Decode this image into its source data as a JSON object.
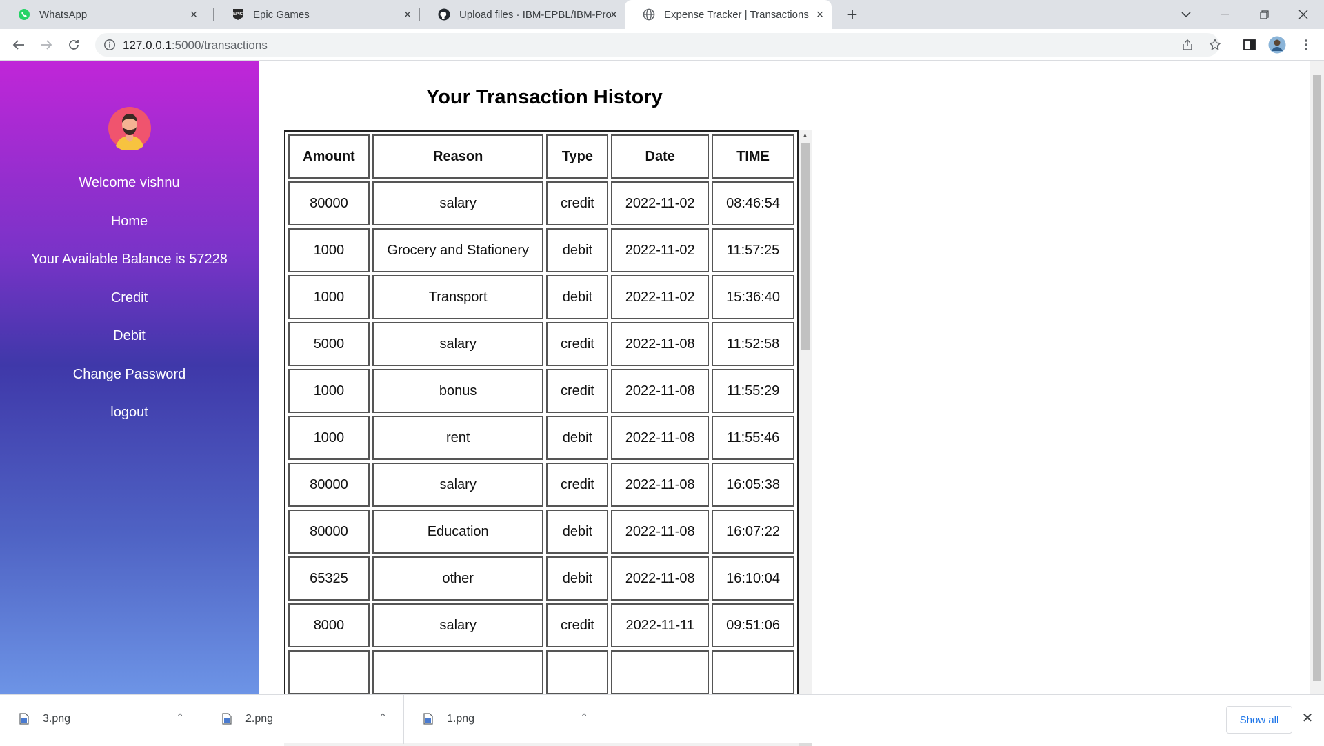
{
  "browser": {
    "tabs": [
      {
        "title": "WhatsApp",
        "icon": "whatsapp-icon",
        "active": false
      },
      {
        "title": "Epic Games",
        "icon": "epic-games-icon",
        "active": false
      },
      {
        "title": "Upload files · IBM-EPBL/IBM-Proj",
        "icon": "github-icon",
        "active": false
      },
      {
        "title": "Expense Tracker | Transactions",
        "icon": "globe-icon",
        "active": true
      }
    ],
    "url_host": "127.0.0.1",
    "url_path": ":5000/transactions"
  },
  "sidebar": {
    "welcome": "Welcome vishnu",
    "home": "Home",
    "balance": "Your Available Balance is 57228",
    "credit": "Credit",
    "debit": "Debit",
    "change_password": "Change Password",
    "logout": "logout"
  },
  "main": {
    "title": "Your Transaction History",
    "columns": [
      "Amount",
      "Reason",
      "Type",
      "Date",
      "TIME"
    ],
    "rows": [
      [
        "80000",
        "salary",
        "credit",
        "2022-11-02",
        "08:46:54"
      ],
      [
        "1000",
        "Grocery and Stationery",
        "debit",
        "2022-11-02",
        "11:57:25"
      ],
      [
        "1000",
        "Transport",
        "debit",
        "2022-11-02",
        "15:36:40"
      ],
      [
        "5000",
        "salary",
        "credit",
        "2022-11-08",
        "11:52:58"
      ],
      [
        "1000",
        "bonus",
        "credit",
        "2022-11-08",
        "11:55:29"
      ],
      [
        "1000",
        "rent",
        "debit",
        "2022-11-08",
        "11:55:46"
      ],
      [
        "80000",
        "salary",
        "credit",
        "2022-11-08",
        "16:05:38"
      ],
      [
        "80000",
        "Education",
        "debit",
        "2022-11-08",
        "16:07:22"
      ],
      [
        "65325",
        "other",
        "debit",
        "2022-11-08",
        "16:10:04"
      ],
      [
        "8000",
        "salary",
        "credit",
        "2022-11-11",
        "09:51:06"
      ]
    ]
  },
  "downloads": {
    "items": [
      "3.png",
      "2.png",
      "1.png"
    ],
    "show_all": "Show all"
  }
}
